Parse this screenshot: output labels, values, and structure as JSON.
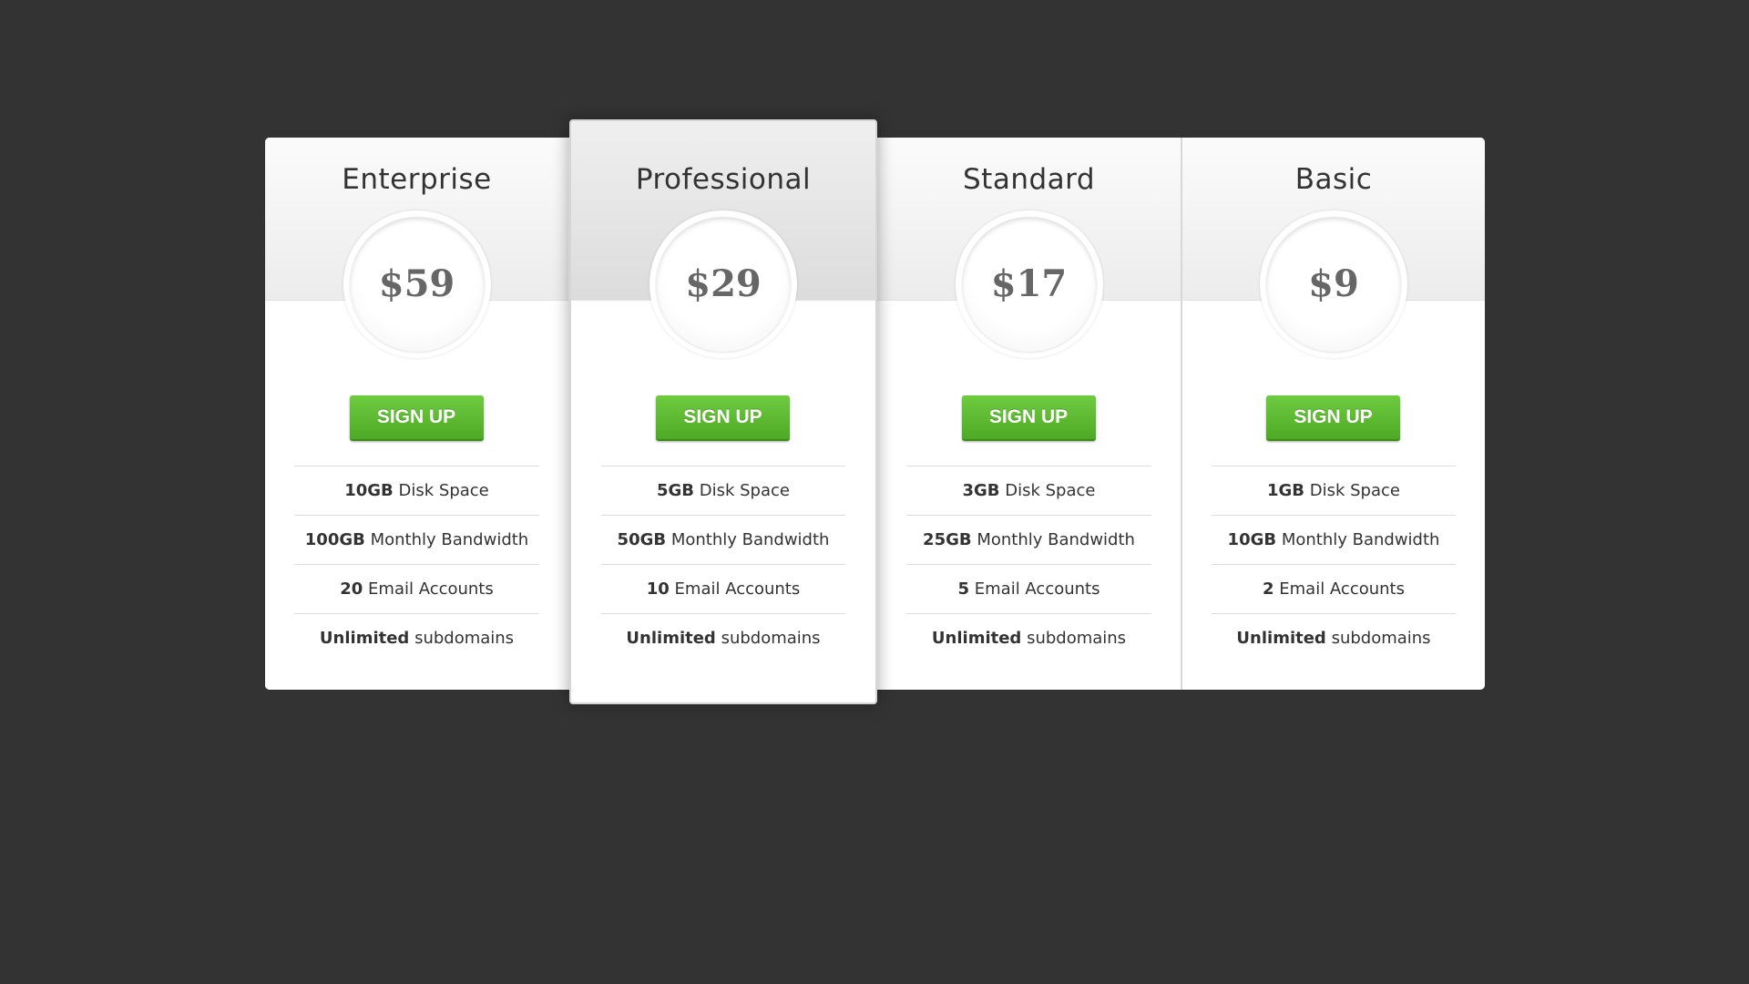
{
  "plans": [
    {
      "name": "Enterprise",
      "price": "$59",
      "cta": "SIGN UP",
      "features": [
        {
          "value": "10GB",
          "label": "Disk Space"
        },
        {
          "value": "100GB",
          "label": "Monthly Bandwidth"
        },
        {
          "value": "20",
          "label": "Email Accounts"
        },
        {
          "value": "Unlimited",
          "label": "subdomains"
        }
      ]
    },
    {
      "name": "Professional",
      "price": "$29",
      "cta": "SIGN UP",
      "featured": true,
      "features": [
        {
          "value": "5GB",
          "label": "Disk Space"
        },
        {
          "value": "50GB",
          "label": "Monthly Bandwidth"
        },
        {
          "value": "10",
          "label": "Email Accounts"
        },
        {
          "value": "Unlimited",
          "label": "subdomains"
        }
      ]
    },
    {
      "name": "Standard",
      "price": "$17",
      "cta": "SIGN UP",
      "features": [
        {
          "value": "3GB",
          "label": "Disk Space"
        },
        {
          "value": "25GB",
          "label": "Monthly Bandwidth"
        },
        {
          "value": "5",
          "label": "Email Accounts"
        },
        {
          "value": "Unlimited",
          "label": "subdomains"
        }
      ]
    },
    {
      "name": "Basic",
      "price": "$9",
      "cta": "SIGN UP",
      "features": [
        {
          "value": "1GB",
          "label": "Disk Space"
        },
        {
          "value": "10GB",
          "label": "Monthly Bandwidth"
        },
        {
          "value": "2",
          "label": "Email Accounts"
        },
        {
          "value": "Unlimited",
          "label": "subdomains"
        }
      ]
    }
  ],
  "colors": {
    "background": "#333333",
    "button": "#5cb832",
    "price_text": "#666666"
  }
}
